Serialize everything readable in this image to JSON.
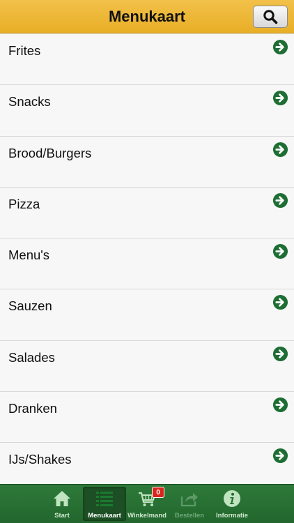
{
  "header": {
    "title": "Menukaart"
  },
  "menu": {
    "items": [
      {
        "label": "Frites"
      },
      {
        "label": "Snacks"
      },
      {
        "label": "Brood/Burgers"
      },
      {
        "label": "Pizza"
      },
      {
        "label": "Menu's"
      },
      {
        "label": "Sauzen"
      },
      {
        "label": "Salades"
      },
      {
        "label": "Dranken"
      },
      {
        "label": "IJs/Shakes"
      }
    ]
  },
  "tabbar": {
    "start": {
      "label": "Start",
      "icon": "home-icon"
    },
    "menukaart": {
      "label": "Menukaart",
      "icon": "list-icon"
    },
    "winkelmand": {
      "label": "Winkelmand",
      "icon": "cart-icon",
      "badge": "0"
    },
    "bestellen": {
      "label": "Bestellen",
      "icon": "share-icon"
    },
    "informatie": {
      "label": "Informatie",
      "icon": "info-icon"
    }
  },
  "colors": {
    "header": "#e8ae26",
    "tabbar": "#2e7a3a",
    "arrow": "#1e6e34",
    "badge": "#d8261c"
  }
}
